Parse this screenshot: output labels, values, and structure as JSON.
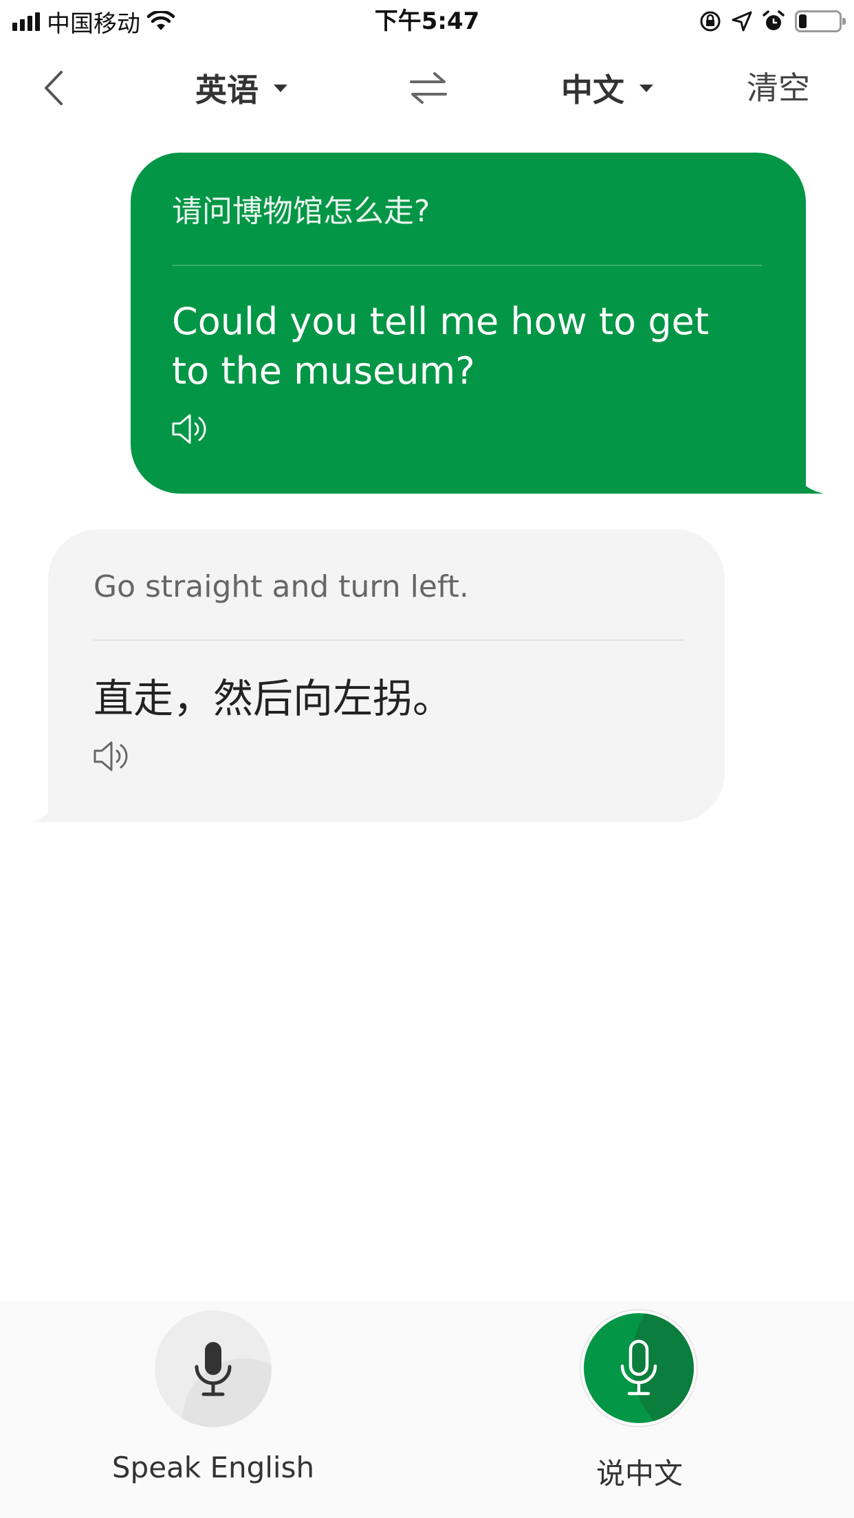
{
  "status_bar": {
    "carrier": "中国移动",
    "time": "下午5:47",
    "battery_level": 0.2,
    "icons": [
      "signal-icon",
      "wifi-icon",
      "rotation-lock-icon",
      "location-icon",
      "alarm-icon",
      "battery-icon"
    ]
  },
  "nav": {
    "source_language": "英语",
    "target_language": "中文",
    "clear_label": "清空",
    "icons": [
      "back-chevron-icon",
      "dropdown-caret-icon",
      "swap-arrows-icon"
    ]
  },
  "conversation": [
    {
      "side": "user",
      "source_text": "请问博物馆怎么走?",
      "translated_text": "Could you tell me how to get to the museum?",
      "color": "#039646"
    },
    {
      "side": "reply",
      "source_text": "Go straight and turn left.",
      "translated_text": "直走，然后向左拐。",
      "color": "#f4f4f4"
    }
  ],
  "bottom": {
    "speak_english_label": "Speak English",
    "speak_chinese_label": "说中文",
    "icons": [
      "microphone-icon"
    ]
  },
  "colors": {
    "brand_green": "#039646",
    "reply_bubble": "#f4f4f4"
  }
}
